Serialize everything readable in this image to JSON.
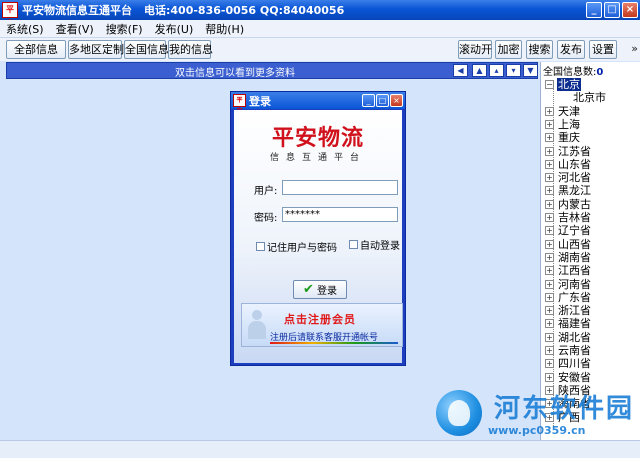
{
  "window": {
    "title": "平安物流信息互通平台",
    "contact": "电话:400-836-0056 QQ:84040056",
    "app_icon_text": "平安"
  },
  "menu": [
    "系统(S)",
    "查看(V)",
    "搜索(F)",
    "发布(U)",
    "帮助(H)"
  ],
  "toolbar": {
    "left": [
      "全部信息",
      "多地区定制",
      "全国信息",
      "我的信息"
    ],
    "right": [
      "滚动开",
      "加密",
      "搜索",
      "发布",
      "设置"
    ],
    "overflow": "»"
  },
  "infobar": {
    "text": "双击信息可以看到更多资料"
  },
  "tree": {
    "header_label": "全国信息数:",
    "header_count": "0",
    "root": "北京",
    "child": "北京市",
    "items": [
      "天津",
      "上海",
      "重庆",
      "江苏省",
      "山东省",
      "河北省",
      "黑龙江",
      "内蒙古",
      "吉林省",
      "辽宁省",
      "山西省",
      "湖南省",
      "江西省",
      "河南省",
      "广东省",
      "浙江省",
      "福建省",
      "湖北省",
      "云南省",
      "四川省",
      "安徽省",
      "陕西省",
      "海南省",
      "广西"
    ]
  },
  "dialog": {
    "title": "登录",
    "brand": "平安物流",
    "brand_sub": "信息互通平台",
    "user_label": "用户:",
    "user_value": "",
    "password_label": "密码:",
    "password_value": "*******",
    "remember_label": "记住用户与密码",
    "remember_checked": false,
    "autologin_label": "自动登录",
    "autologin_checked": false,
    "login_button": "登录",
    "banner_title": "点击注册会员",
    "banner_sub": "注册后请联系客服开通帐号"
  },
  "watermark": {
    "name": "河东软件园",
    "url": "www.pc0359.cn"
  }
}
